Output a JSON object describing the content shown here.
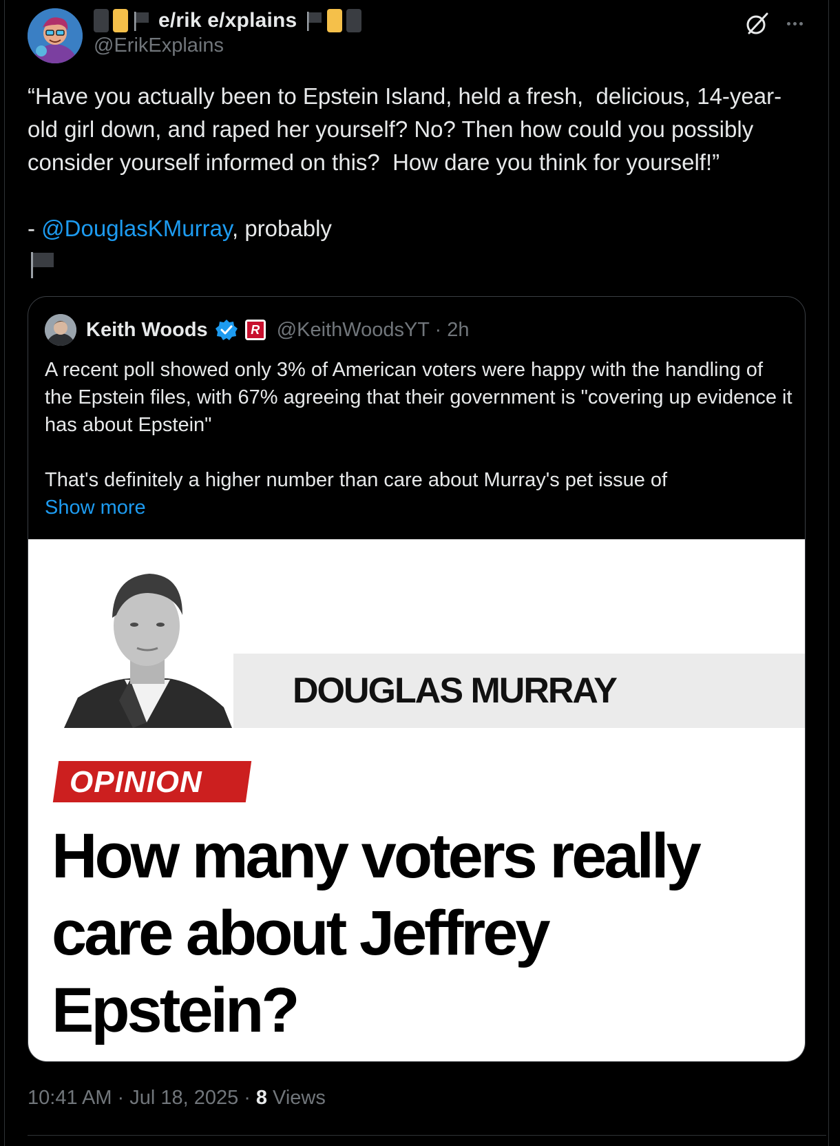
{
  "author": {
    "display_name": "e/rik e/xplains",
    "handle": "@ErikExplains"
  },
  "tweet": {
    "text": "“Have you actually been to Epstein Island, held a fresh,  delicious, 14-year-old girl down, and raped her yourself? No? Then how could you possibly consider yourself informed on this?  How dare you think for yourself!”",
    "sig_prefix": "- ",
    "mention": "@DouglasKMurray",
    "sig_suffix": ", probably"
  },
  "quote": {
    "name": "Keith Woods",
    "handle_time": "@KeithWoodsYT · 2h",
    "badge_letter": "R",
    "text1": "A recent poll showed only 3% of American voters were happy with the handling of the Epstein files, with 67% agreeing that their government is \"covering up evidence it has about Epstein\"",
    "text2": "That's definitely a higher number than care about Murray's pet issue of",
    "show_more": "Show more",
    "media": {
      "byline": "DOUGLAS MURRAY",
      "tag": "OPINION",
      "headline": "How many voters really care about Jeffrey Epstein?"
    }
  },
  "footer": {
    "time": "10:41 AM",
    "sep1": "·",
    "date": "Jul 18, 2025",
    "sep2": "·",
    "views_count": "8",
    "views_label": "Views"
  },
  "colors": {
    "background": "#000000",
    "text": "#e7e9ea",
    "secondary": "#71767b",
    "link": "#1d9bf0",
    "opinion_red": "#cc1f1f"
  },
  "icons": [
    "grok-icon",
    "more-icon",
    "black-flag-icon",
    "verified-icon"
  ]
}
